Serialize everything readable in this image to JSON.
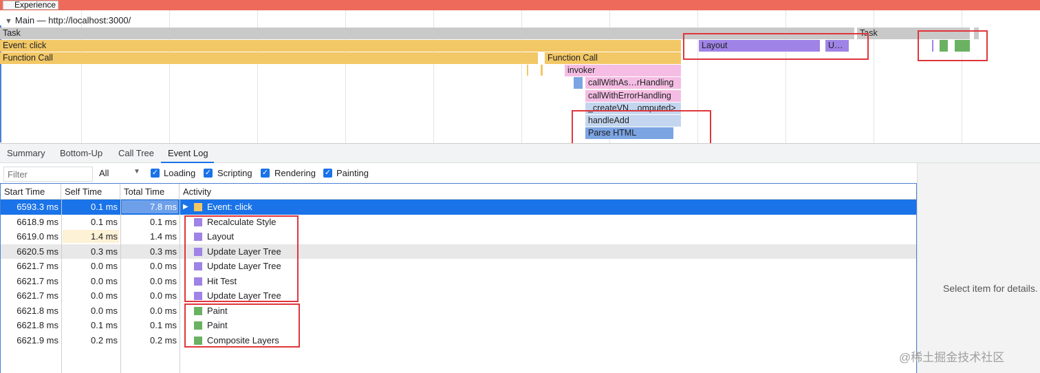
{
  "experience": {
    "label": "Experience"
  },
  "main": {
    "title": "Main — http://localhost:3000/"
  },
  "flame": {
    "task1": "Task",
    "task2": "Task",
    "event_click": "Event: click",
    "function_call1": "Function Call",
    "function_call2": "Function Call",
    "layout": "Layout",
    "u_abbrev": "U…",
    "invoker": "invoker",
    "call_with_async": "callWithAs…rHandling",
    "call_with_error": "callWithErrorHandling",
    "create_vn": "_createVN…omputed>",
    "handle_add": "handleAdd",
    "parse_html": "Parse HTML"
  },
  "tabs": [
    "Summary",
    "Bottom-Up",
    "Call Tree",
    "Event Log"
  ],
  "active_tab": "Event Log",
  "filter": {
    "placeholder": "Filter",
    "select_value": "All",
    "checkboxes": [
      "Loading",
      "Scripting",
      "Rendering",
      "Painting"
    ]
  },
  "table": {
    "headers": [
      "Start Time",
      "Self Time",
      "Total Time",
      "Activity"
    ],
    "rows": [
      {
        "start": "6593.3 ms",
        "self": "0.1 ms",
        "total": "7.8 ms",
        "activity": "Event: click",
        "color": "#f2c765"
      },
      {
        "start": "6618.9 ms",
        "self": "0.1 ms",
        "total": "0.1 ms",
        "activity": "Recalculate Style",
        "color": "#9f83e6"
      },
      {
        "start": "6619.0 ms",
        "self": "1.4 ms",
        "total": "1.4 ms",
        "activity": "Layout",
        "color": "#9f83e6"
      },
      {
        "start": "6620.5 ms",
        "self": "0.3 ms",
        "total": "0.3 ms",
        "activity": "Update Layer Tree",
        "color": "#9f83e6"
      },
      {
        "start": "6621.7 ms",
        "self": "0.0 ms",
        "total": "0.0 ms",
        "activity": "Update Layer Tree",
        "color": "#9f83e6"
      },
      {
        "start": "6621.7 ms",
        "self": "0.0 ms",
        "total": "0.0 ms",
        "activity": "Hit Test",
        "color": "#9f83e6"
      },
      {
        "start": "6621.7 ms",
        "self": "0.0 ms",
        "total": "0.0 ms",
        "activity": "Update Layer Tree",
        "color": "#9f83e6"
      },
      {
        "start": "6621.8 ms",
        "self": "0.0 ms",
        "total": "0.0 ms",
        "activity": "Paint",
        "color": "#6ab262"
      },
      {
        "start": "6621.8 ms",
        "self": "0.1 ms",
        "total": "0.1 ms",
        "activity": "Paint",
        "color": "#6ab262"
      },
      {
        "start": "6621.9 ms",
        "self": "0.2 ms",
        "total": "0.2 ms",
        "activity": "Composite Layers",
        "color": "#6ab262"
      }
    ]
  },
  "details": {
    "placeholder": "Select item for details."
  },
  "watermark": "@稀土掘金技术社区",
  "colors": {
    "accent": "#1a73e8",
    "selected_row": "#1a73e8",
    "highlight_box": "#e0353a"
  }
}
